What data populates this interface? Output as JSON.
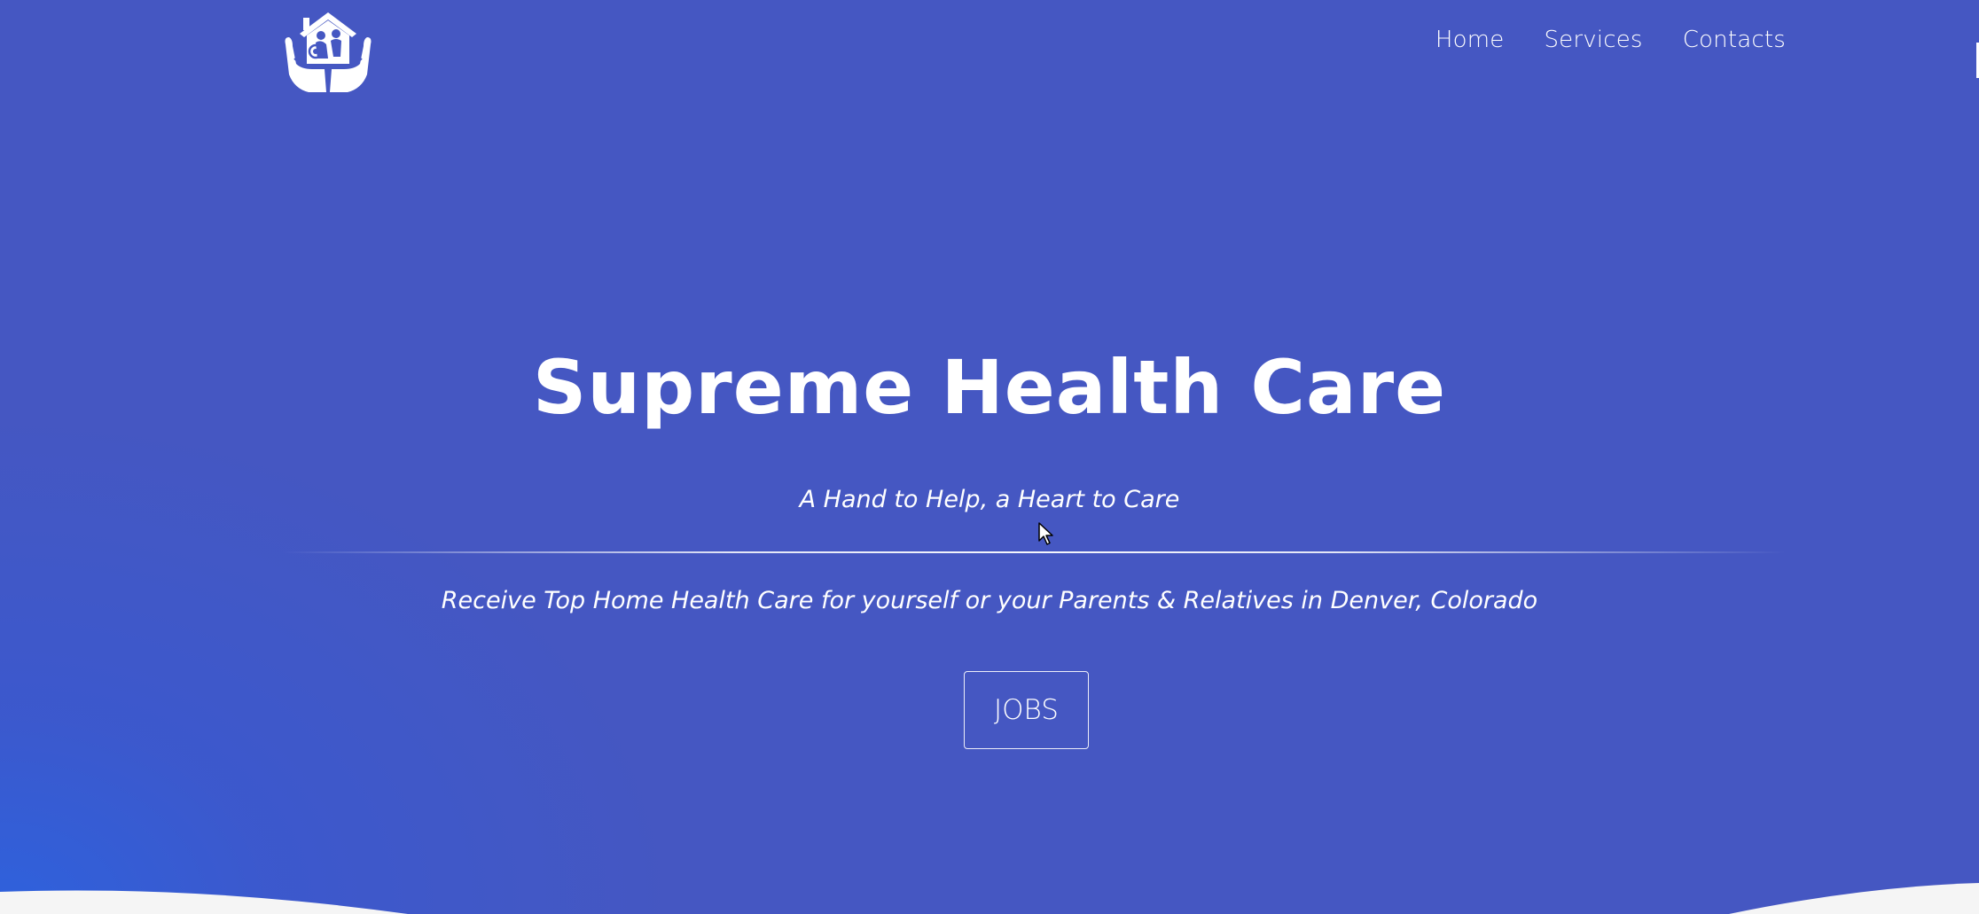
{
  "brand": {
    "logo_icon": "hands-holding-house-family-icon"
  },
  "nav": {
    "items": [
      {
        "label": "Home"
      },
      {
        "label": "Services"
      },
      {
        "label": "Contacts"
      }
    ]
  },
  "hero": {
    "title": "Supreme Health Care",
    "tagline": "A Hand to Help, a Heart to Care",
    "description": "Receive Top Home Health Care for yourself or your Parents & Relatives in Denver, Colorado",
    "button_label": "JOBS"
  },
  "colors": {
    "hero_background": "#4557c2",
    "hero_glow": "#2d62de",
    "text": "#ffffff",
    "page_background": "#f5f5f5"
  }
}
